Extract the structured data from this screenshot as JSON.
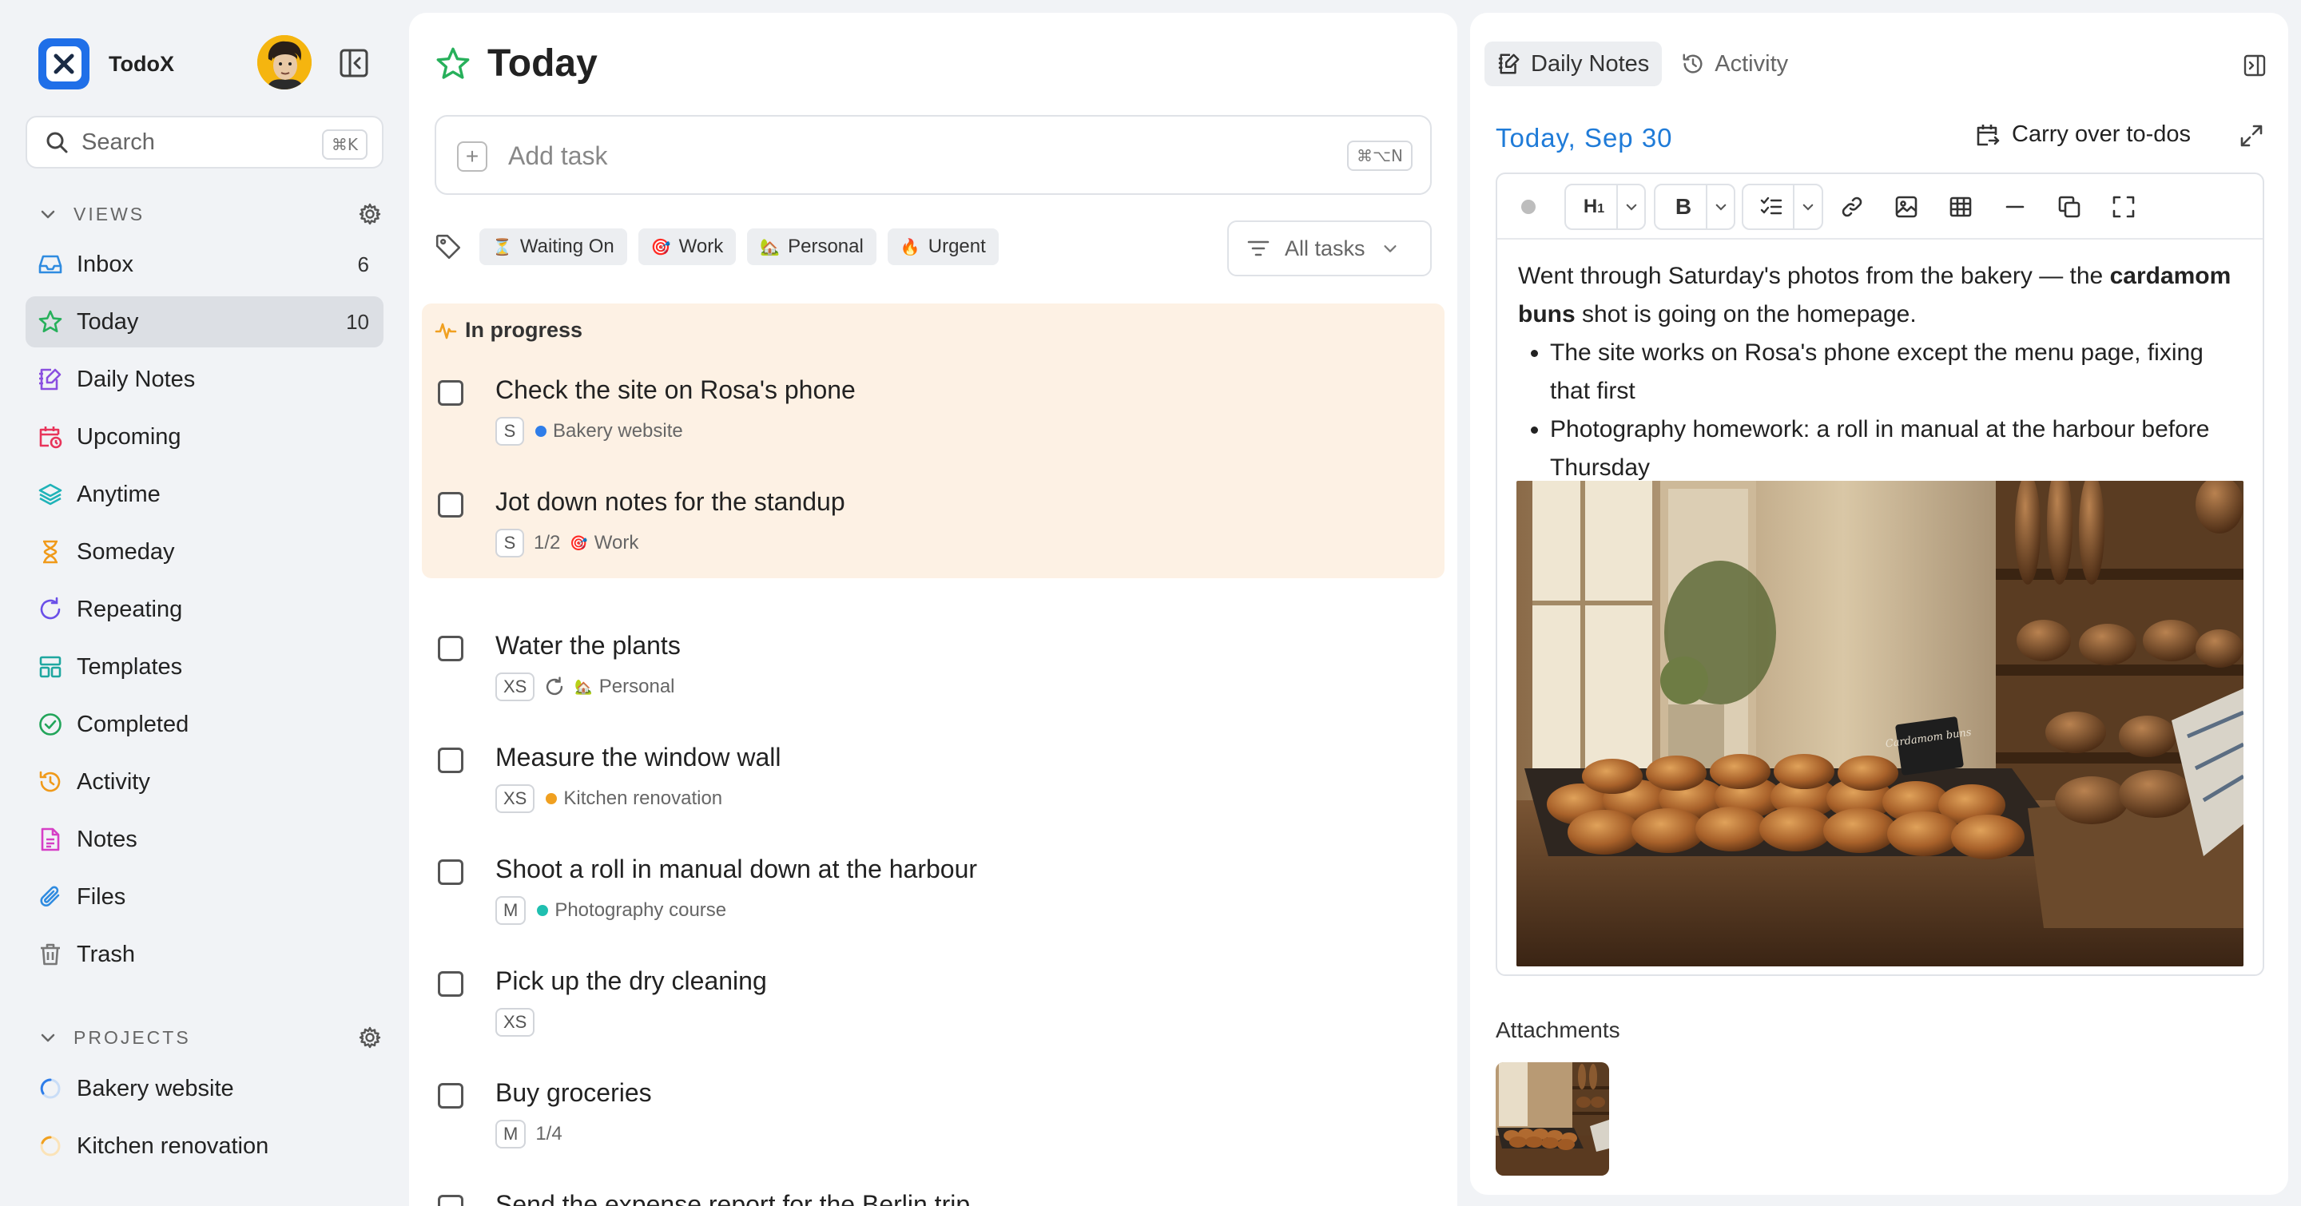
{
  "app": {
    "name": "TodoX"
  },
  "search": {
    "placeholder": "Search",
    "shortcut": "⌘K"
  },
  "sidebar": {
    "views_label": "VIEWS",
    "views": [
      {
        "label": "Inbox",
        "count": "6",
        "icon": "inbox-icon"
      },
      {
        "label": "Today",
        "count": "10",
        "icon": "star-icon",
        "active": true
      },
      {
        "label": "Daily Notes",
        "count": "",
        "icon": "notebook-pen-icon"
      },
      {
        "label": "Upcoming",
        "count": "",
        "icon": "calendar-clock-icon"
      },
      {
        "label": "Anytime",
        "count": "",
        "icon": "layers-icon"
      },
      {
        "label": "Someday",
        "count": "",
        "icon": "hourglass-icon"
      },
      {
        "label": "Repeating",
        "count": "",
        "icon": "repeat-icon"
      },
      {
        "label": "Templates",
        "count": "",
        "icon": "template-icon"
      },
      {
        "label": "Completed",
        "count": "",
        "icon": "check-circle-icon"
      },
      {
        "label": "Activity",
        "count": "",
        "icon": "history-icon"
      },
      {
        "label": "Notes",
        "count": "",
        "icon": "note-icon"
      },
      {
        "label": "Files",
        "count": "",
        "icon": "paperclip-icon"
      },
      {
        "label": "Trash",
        "count": "",
        "icon": "trash-icon"
      }
    ],
    "projects_label": "PROJECTS",
    "projects": [
      {
        "label": "Bakery website",
        "color": "#2e7de9"
      },
      {
        "label": "Kitchen renovation",
        "color": "#f0a020"
      }
    ]
  },
  "main": {
    "title": "Today",
    "add_task": {
      "placeholder": "Add task",
      "shortcut": "⌘⌥N"
    },
    "tags": [
      {
        "label": "Waiting On",
        "emoji": "⏳"
      },
      {
        "label": "Work",
        "emoji": "🎯"
      },
      {
        "label": "Personal",
        "emoji": "🏡"
      },
      {
        "label": "Urgent",
        "emoji": "🔥"
      }
    ],
    "filter": {
      "label": "All tasks"
    },
    "in_progress_label": "In progress",
    "in_progress_tasks": [
      {
        "title": "Check the site on Rosa's phone",
        "size": "S",
        "project": "Bakery website",
        "project_color": "#2e7de9"
      },
      {
        "title": "Jot down notes for the standup",
        "size": "S",
        "progress": "1/2",
        "tag": "Work",
        "tag_emoji": "🎯"
      }
    ],
    "tasks": [
      {
        "title": "Water the plants",
        "size": "XS",
        "repeat": true,
        "tag": "Personal",
        "tag_emoji": "🏡"
      },
      {
        "title": "Measure the window wall",
        "size": "XS",
        "project": "Kitchen renovation",
        "project_color": "#f0a020"
      },
      {
        "title": "Shoot a roll in manual down at the harbour",
        "size": "M",
        "project": "Photography course",
        "project_color": "#1fbfb0"
      },
      {
        "title": "Pick up the dry cleaning",
        "size": "XS"
      },
      {
        "title": "Buy groceries",
        "size": "M",
        "progress": "1/4"
      },
      {
        "title": "Send the expense report for the Berlin trip"
      }
    ]
  },
  "right_panel": {
    "tabs": [
      {
        "label": "Daily Notes",
        "icon": "notebook-pen-icon",
        "active": true
      },
      {
        "label": "Activity",
        "icon": "history-icon",
        "active": false
      }
    ],
    "date": "Today, Sep 30",
    "carry_over_label": "Carry over to-dos",
    "note": {
      "p1_before": "Went through Saturday's photos from the bakery — the",
      "p1_bold": "cardamom buns",
      "p1_after": "shot is going on the homepage.",
      "bullets": [
        "The site works on Rosa's phone except the menu page, fixing that first",
        "Photography homework: a roll in manual at the harbour before Thursday"
      ],
      "sign_text": "Cardamom buns"
    },
    "attachments_label": "Attachments"
  }
}
